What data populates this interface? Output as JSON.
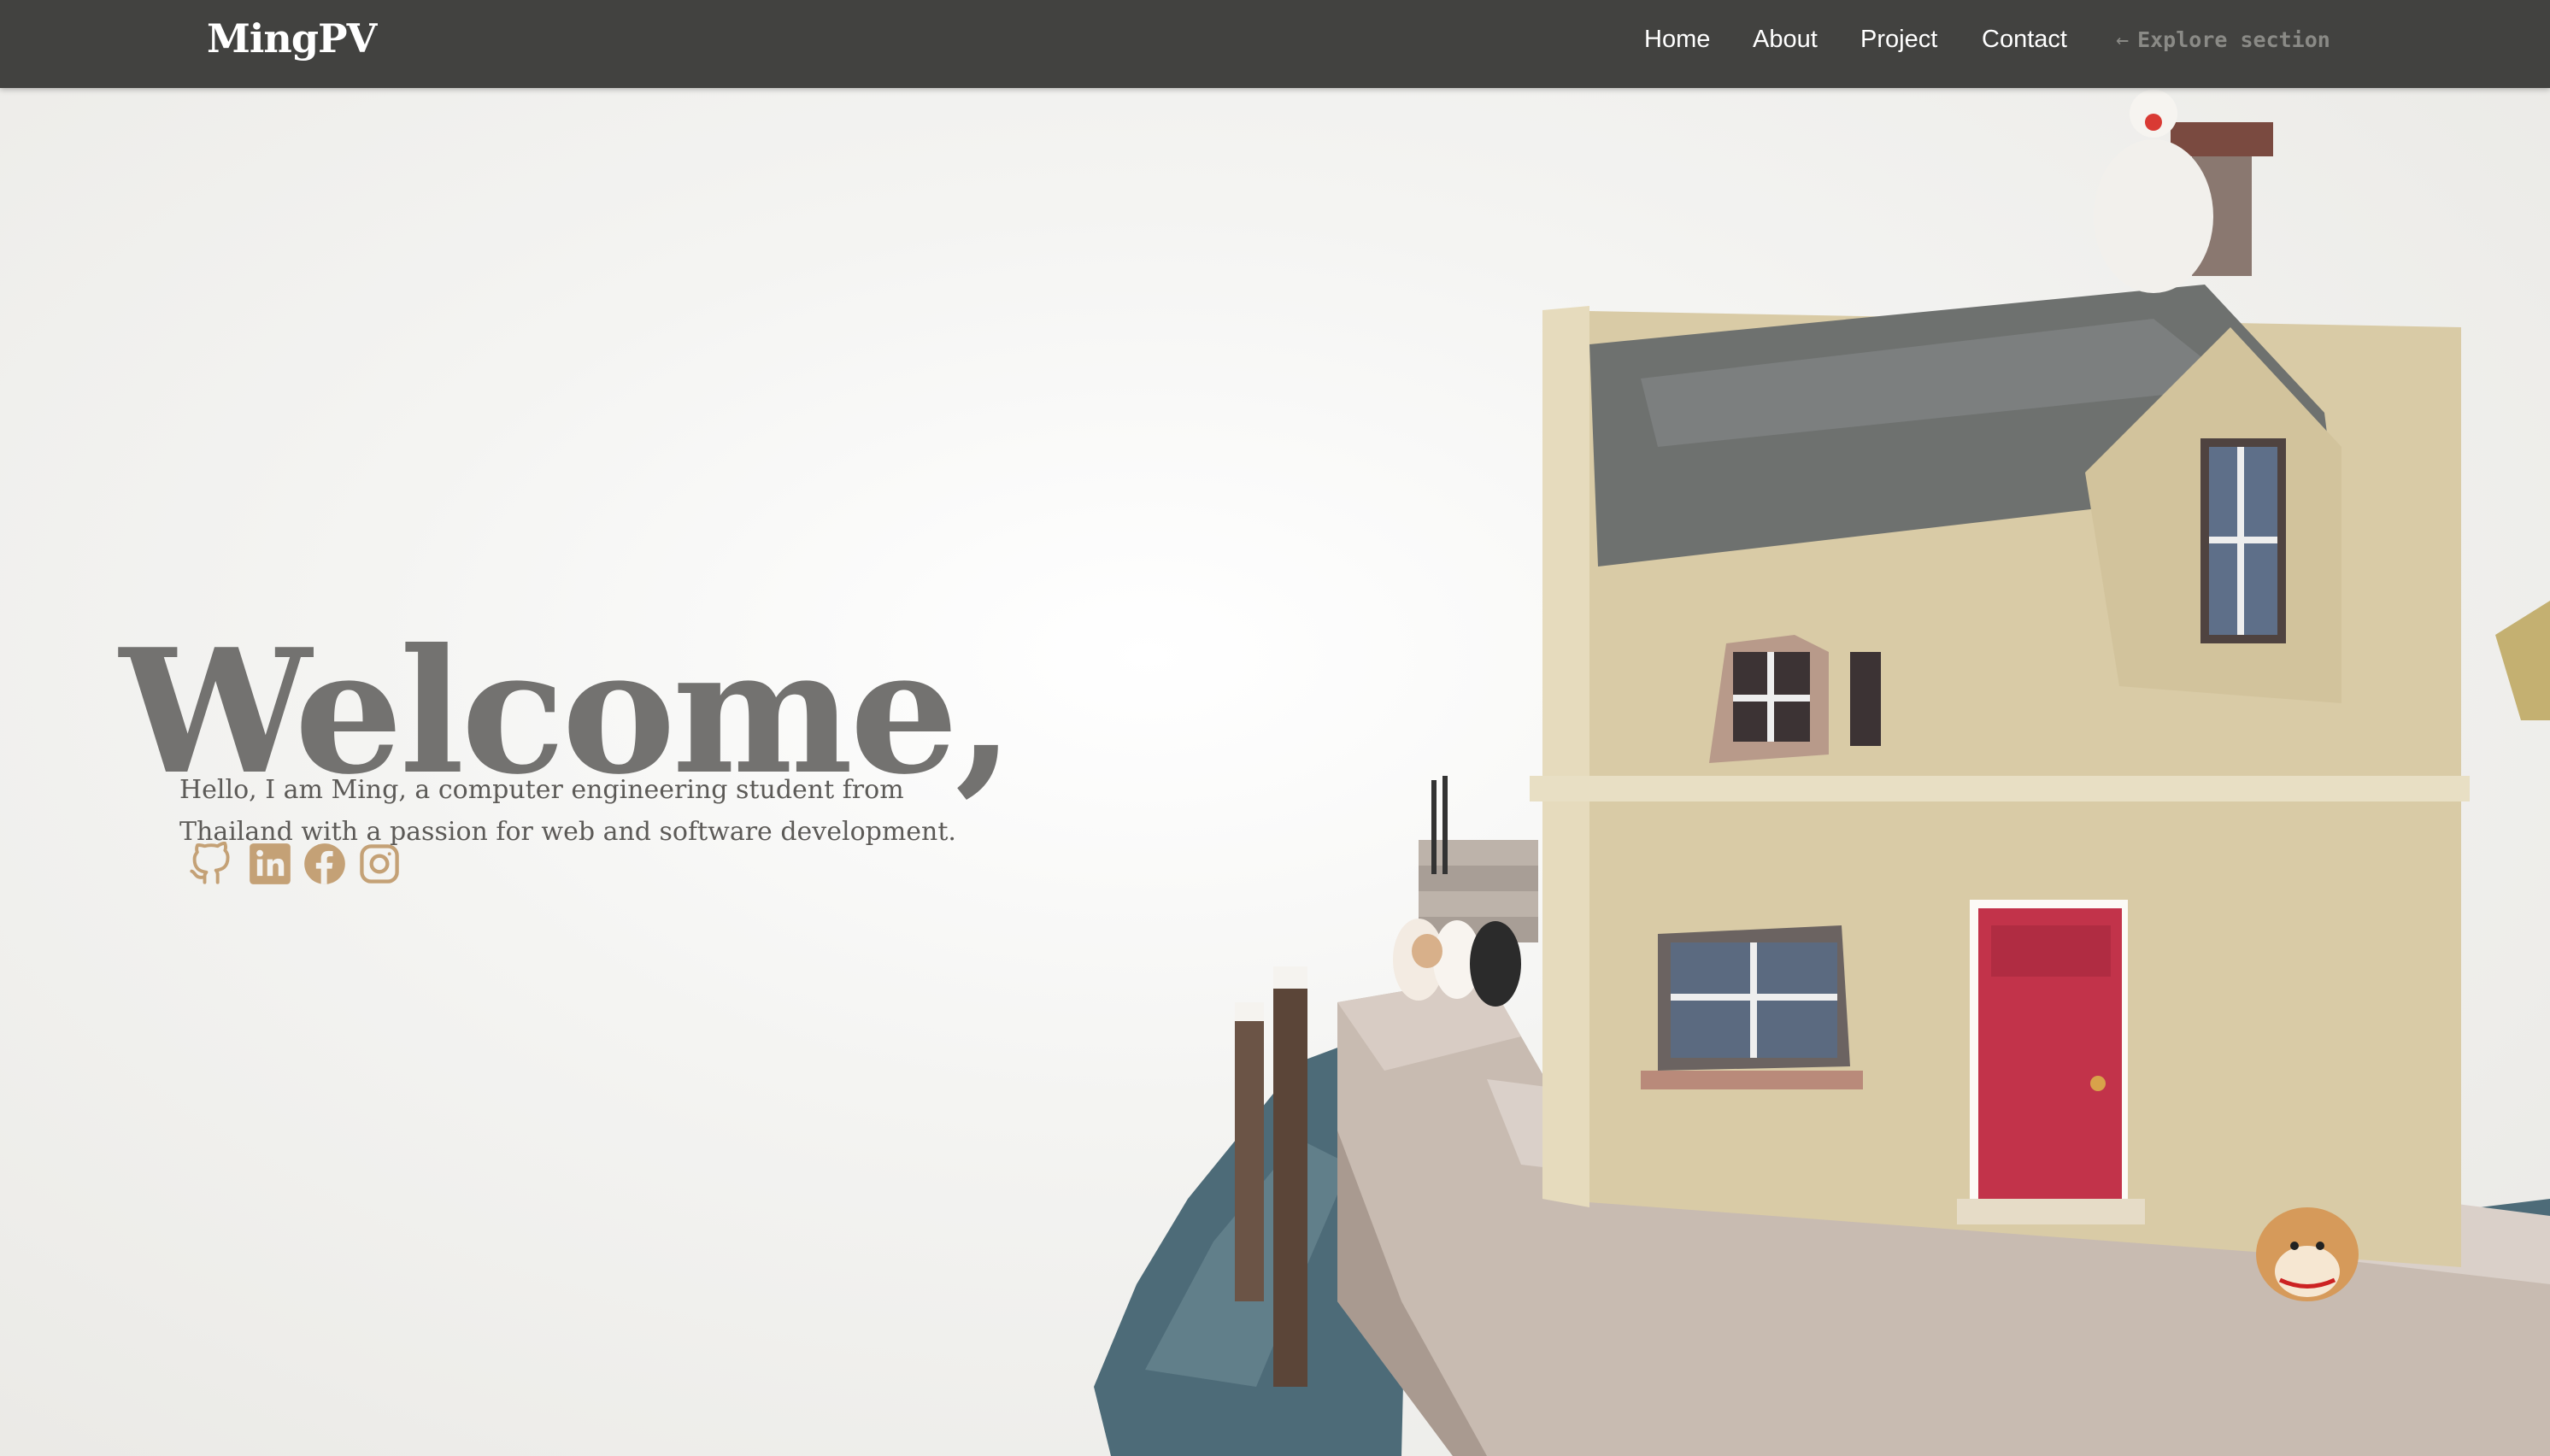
{
  "navbar": {
    "brand": "MingPV",
    "links": [
      "Home",
      "About",
      "Project",
      "Contact"
    ],
    "explore_label": "Explore section",
    "explore_icon": "arrow-left-icon"
  },
  "hero": {
    "title": "Welcome,",
    "description": "Hello, I am Ming, a computer engineering student from Thailand with a passion for web and software development."
  },
  "socials": [
    {
      "icon": "github-icon"
    },
    {
      "icon": "linkedin-icon"
    },
    {
      "icon": "facebook-icon"
    },
    {
      "icon": "instagram-icon"
    }
  ],
  "colors": {
    "navbar_bg": "#424240",
    "title": "#737270",
    "text": "#5c5a57",
    "social_accent": "#c4a176",
    "door": "#c2334a",
    "wall": "#d9cba6",
    "roof": "#6e716f",
    "water": "#4d6b78"
  }
}
